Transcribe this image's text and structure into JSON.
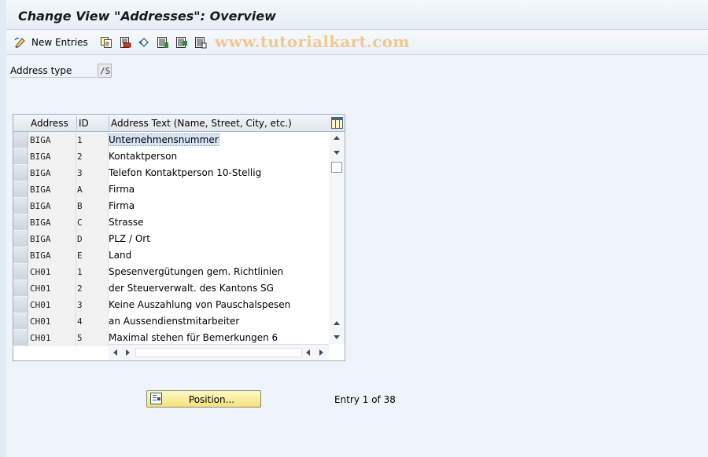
{
  "header": {
    "title": "Change View \"Addresses\": Overview"
  },
  "toolbar": {
    "new_entries_label": "New Entries",
    "watermark": "www.tutorialkart.com",
    "icons": [
      "change-display-icon",
      "copy-icon",
      "delete-icon",
      "undo-icon",
      "select-all-icon",
      "select-block-icon",
      "deselect-all-icon"
    ]
  },
  "filter": {
    "label": "Address type",
    "value": "/S"
  },
  "table": {
    "columns": [
      "Address",
      "ID",
      "Address Text (Name, Street, City, etc.)"
    ],
    "rows": [
      {
        "address": "BIGA",
        "id": "1",
        "text": "Unternehmensnummer",
        "selected": true
      },
      {
        "address": "BIGA",
        "id": "2",
        "text": "Kontaktperson"
      },
      {
        "address": "BIGA",
        "id": "3",
        "text": "Telefon Kontaktperson 10-Stellig"
      },
      {
        "address": "BIGA",
        "id": "A",
        "text": "Firma"
      },
      {
        "address": "BIGA",
        "id": "B",
        "text": "Firma"
      },
      {
        "address": "BIGA",
        "id": "C",
        "text": "Strasse"
      },
      {
        "address": "BIGA",
        "id": "D",
        "text": "PLZ / Ort"
      },
      {
        "address": "BIGA",
        "id": "E",
        "text": "Land"
      },
      {
        "address": "CH01",
        "id": "1",
        "text": "Spesenvergütungen gem. Richtlinien"
      },
      {
        "address": "CH01",
        "id": "2",
        "text": " der Steuerverwalt. des Kantons SG"
      },
      {
        "address": "CH01",
        "id": "3",
        "text": "Keine Auszahlung von Pauschalspesen"
      },
      {
        "address": "CH01",
        "id": "4",
        "text": " an Aussendienstmitarbeiter"
      },
      {
        "address": "CH01",
        "id": "5",
        "text": "Maximal stehen für Bemerkungen  6"
      }
    ]
  },
  "footer": {
    "position_label": "Position...",
    "entry_text": "Entry 1 of 38"
  },
  "colors": {
    "button": "#f5e27d",
    "selection": "#d6e4f3",
    "watermark": "#f0c896"
  }
}
